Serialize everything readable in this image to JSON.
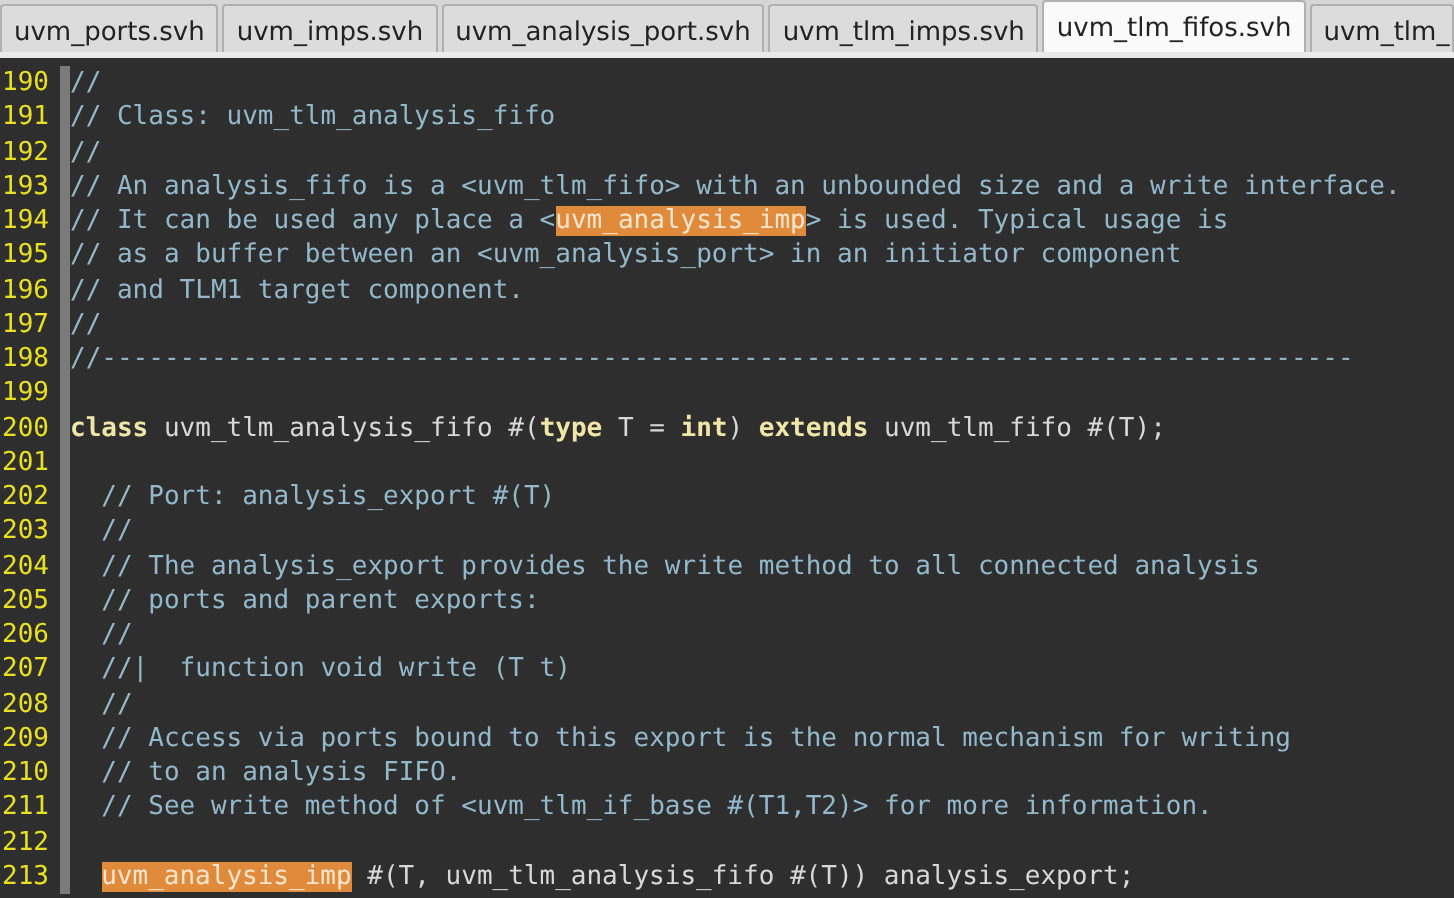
{
  "tabs": [
    {
      "label": "uvm_ports.svh",
      "selected": false
    },
    {
      "label": "uvm_imps.svh",
      "selected": false
    },
    {
      "label": "uvm_analysis_port.svh",
      "selected": false
    },
    {
      "label": "uvm_tlm_imps.svh",
      "selected": false
    },
    {
      "label": "uvm_tlm_fifos.svh",
      "selected": true
    },
    {
      "label": "uvm_tlm_",
      "selected": false
    }
  ],
  "lines": [
    {
      "number": "190",
      "segments": [
        {
          "kind": "comment",
          "text": "//"
        }
      ]
    },
    {
      "number": "191",
      "segments": [
        {
          "kind": "comment",
          "text": "// Class: uvm_tlm_analysis_fifo"
        }
      ]
    },
    {
      "number": "192",
      "segments": [
        {
          "kind": "comment",
          "text": "//"
        }
      ]
    },
    {
      "number": "193",
      "segments": [
        {
          "kind": "comment",
          "text": "// An analysis_fifo is a <uvm_tlm_fifo> with an unbounded size and a write interface."
        }
      ]
    },
    {
      "number": "194",
      "segments": [
        {
          "kind": "comment",
          "text": "// It can be used any place a <"
        },
        {
          "kind": "highlight",
          "text": "uvm_analysis_imp"
        },
        {
          "kind": "comment",
          "text": "> is used. Typical usage is"
        }
      ]
    },
    {
      "number": "195",
      "segments": [
        {
          "kind": "comment",
          "text": "// as a buffer between an <uvm_analysis_port> in an initiator component"
        }
      ]
    },
    {
      "number": "196",
      "segments": [
        {
          "kind": "comment",
          "text": "// and TLM1 target component."
        }
      ]
    },
    {
      "number": "197",
      "segments": [
        {
          "kind": "comment",
          "text": "//"
        }
      ]
    },
    {
      "number": "198",
      "segments": [
        {
          "kind": "comment",
          "text": "//--------------------------------------------------------------------------------"
        }
      ]
    },
    {
      "number": "199"
    },
    {
      "number": "200",
      "segments": [
        {
          "kind": "keyword",
          "text": "class"
        },
        {
          "kind": "code",
          "text": " uvm_tlm_analysis_fifo #("
        },
        {
          "kind": "keyword",
          "text": "type"
        },
        {
          "kind": "code",
          "text": " T = "
        },
        {
          "kind": "keyword",
          "text": "int"
        },
        {
          "kind": "code",
          "text": ") "
        },
        {
          "kind": "keyword",
          "text": "extends"
        },
        {
          "kind": "code",
          "text": " uvm_tlm_fifo #(T);"
        }
      ]
    },
    {
      "number": "201"
    },
    {
      "number": "202",
      "segments": [
        {
          "kind": "comment",
          "text": "  // Port: analysis_export #(T)"
        }
      ]
    },
    {
      "number": "203",
      "segments": [
        {
          "kind": "comment",
          "text": "  //"
        }
      ]
    },
    {
      "number": "204",
      "segments": [
        {
          "kind": "comment",
          "text": "  // The analysis_export provides the write method to all connected analysis"
        }
      ]
    },
    {
      "number": "205",
      "segments": [
        {
          "kind": "comment",
          "text": "  // ports and parent exports:"
        }
      ]
    },
    {
      "number": "206",
      "segments": [
        {
          "kind": "comment",
          "text": "  //"
        }
      ]
    },
    {
      "number": "207",
      "segments": [
        {
          "kind": "comment",
          "text": "  //|  function void write (T t)"
        }
      ]
    },
    {
      "number": "208",
      "segments": [
        {
          "kind": "comment",
          "text": "  //"
        }
      ]
    },
    {
      "number": "209",
      "segments": [
        {
          "kind": "comment",
          "text": "  // Access via ports bound to this export is the normal mechanism for writing"
        }
      ]
    },
    {
      "number": "210",
      "segments": [
        {
          "kind": "comment",
          "text": "  // to an analysis FIFO."
        }
      ]
    },
    {
      "number": "211",
      "segments": [
        {
          "kind": "comment",
          "text": "  // See write method of <uvm_tlm_if_base #(T1,T2)> for more information."
        }
      ]
    },
    {
      "number": "212"
    },
    {
      "number": "213",
      "segments": [
        {
          "kind": "highlight",
          "text": "uvm_analysis_imp",
          "indent": true
        },
        {
          "kind": "code",
          "text": " #(T, uvm_tlm_analysis_fifo #(T)) analysis_export;"
        }
      ]
    }
  ]
}
